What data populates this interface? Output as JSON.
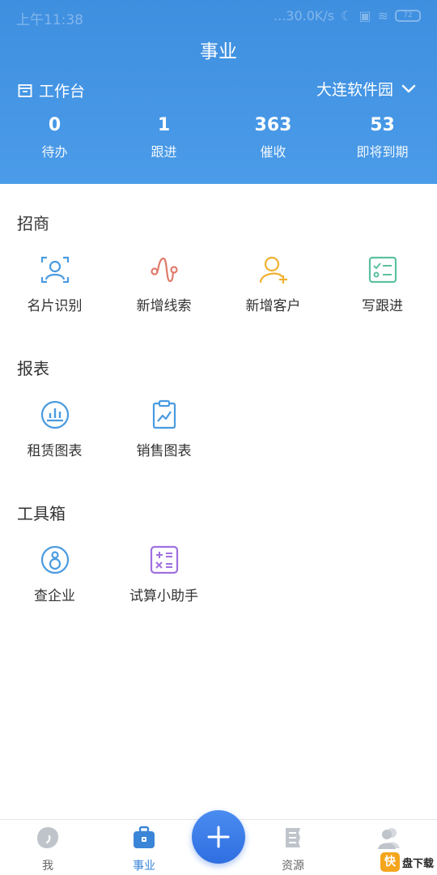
{
  "status": {
    "time": "上午11:38",
    "network": "...30.0K/s",
    "battery": "72"
  },
  "header": {
    "title": "事业",
    "workbench_label": "工作台",
    "park_name": "大连软件园"
  },
  "stats": [
    {
      "value": "0",
      "label": "待办"
    },
    {
      "value": "1",
      "label": "跟进"
    },
    {
      "value": "363",
      "label": "催收"
    },
    {
      "value": "53",
      "label": "即将到期"
    }
  ],
  "sections": {
    "investment": {
      "title": "招商",
      "items": [
        {
          "label": "名片识别",
          "icon": "card-scan-icon"
        },
        {
          "label": "新增线索",
          "icon": "lead-icon"
        },
        {
          "label": "新增客户",
          "icon": "add-customer-icon"
        },
        {
          "label": "写跟进",
          "icon": "followup-icon"
        }
      ]
    },
    "reports": {
      "title": "报表",
      "items": [
        {
          "label": "租赁图表",
          "icon": "lease-chart-icon"
        },
        {
          "label": "销售图表",
          "icon": "sales-chart-icon"
        }
      ]
    },
    "tools": {
      "title": "工具箱",
      "items": [
        {
          "label": "查企业",
          "icon": "company-search-icon"
        },
        {
          "label": "试算小助手",
          "icon": "calculator-icon"
        }
      ]
    }
  },
  "tabbar": {
    "items": [
      {
        "label": "我",
        "icon": "profile-bubble-icon"
      },
      {
        "label": "事业",
        "icon": "briefcase-icon"
      },
      {
        "label": "资源",
        "icon": "document-icon"
      },
      {
        "label": "",
        "icon": "contacts-icon"
      }
    ],
    "fab_icon": "plus-icon"
  },
  "watermark": {
    "badge": "快",
    "text": "盘下载"
  },
  "colors": {
    "header_blue": "#3f8fe0",
    "active_tab": "#3a85d8",
    "icon_blue": "#4a9be0",
    "icon_red": "#e07a6a",
    "icon_yellow": "#f0b030",
    "icon_green": "#5cc0a0",
    "icon_purple": "#a070e0"
  }
}
